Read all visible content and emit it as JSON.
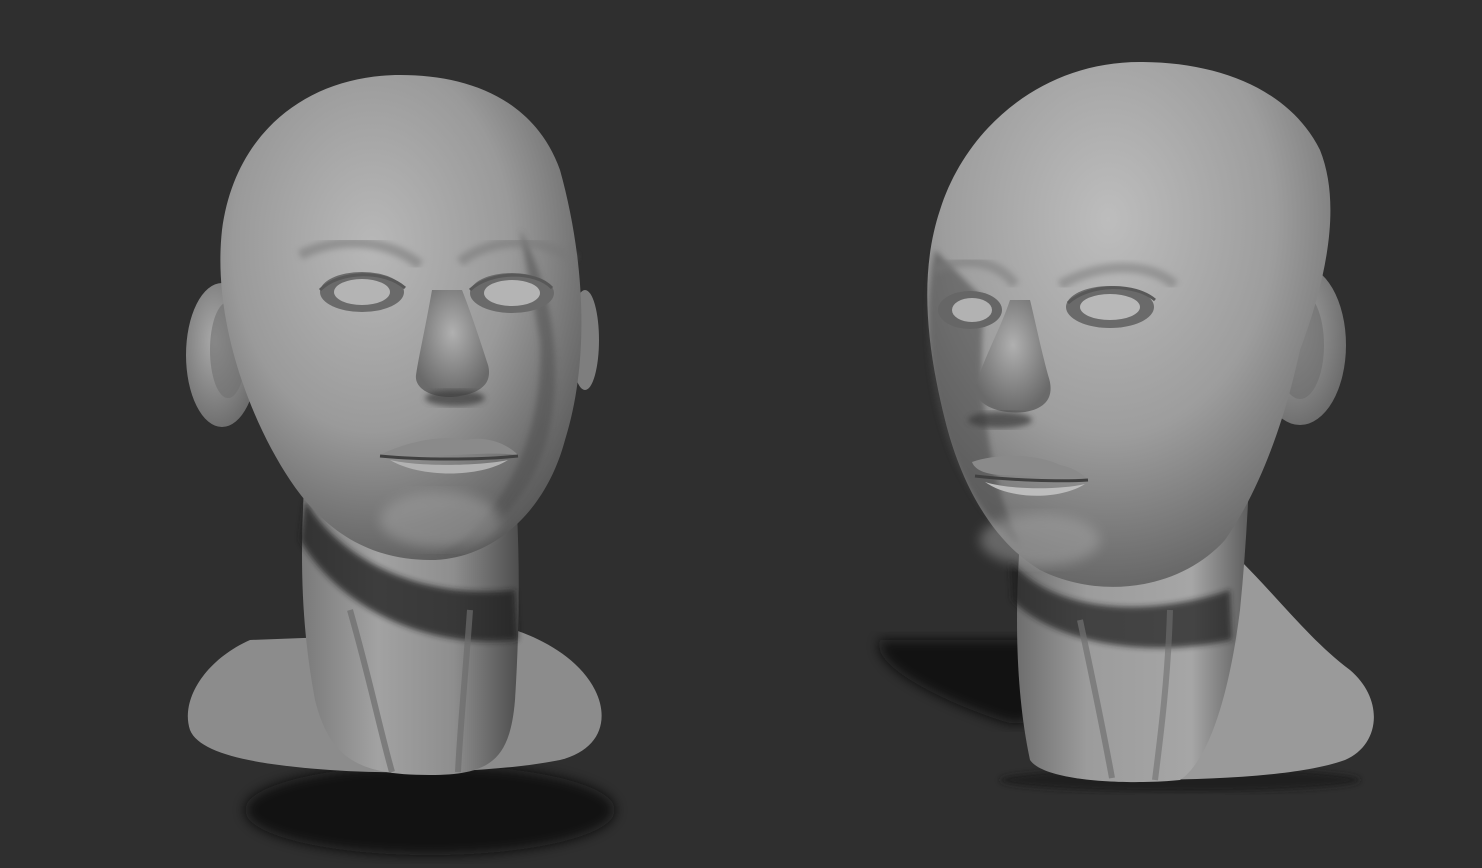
{
  "scene": {
    "background_color": "#2f2f2f",
    "clay_color": "#9a9a9a",
    "objects": [
      {
        "name": "sculpt-head-front",
        "view": "front"
      },
      {
        "name": "sculpt-head-three-quarter",
        "view": "three-quarter"
      }
    ]
  }
}
